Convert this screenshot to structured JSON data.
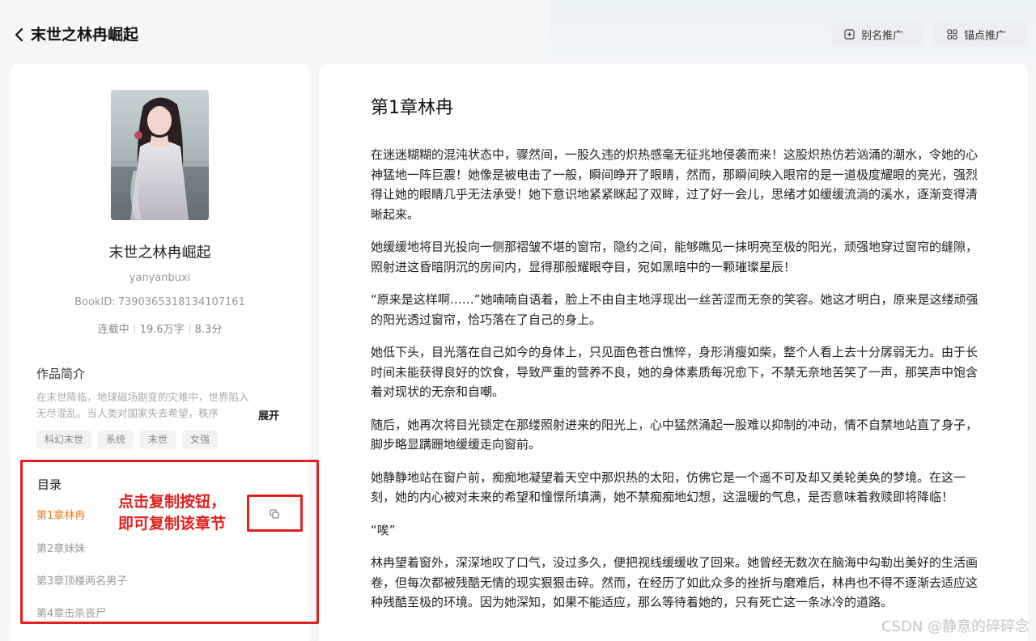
{
  "header": {
    "title": "末世之林冉崛起",
    "alias_button": "别名推广",
    "anchor_button": "锚点推广"
  },
  "book": {
    "title": "末世之林冉崛起",
    "author": "yanyanbuxi",
    "book_id_label": "BookID:",
    "book_id": "7390365318134107161",
    "status": "连载中",
    "word_count": "19.6万字",
    "rating": "8.3分"
  },
  "intro": {
    "heading": "作品简介",
    "text": "在末世降临，地球磁场剧变的灾难中，世界陷入无尽混乱。当人类对国家失去希望，秩序",
    "expand": "展开"
  },
  "tags": [
    "科幻末世",
    "系统",
    "末世",
    "女强"
  ],
  "toc": {
    "heading": "目录",
    "items": [
      "第1章林冉",
      "第2章妹妹",
      "第3章顶楼两名男子",
      "第4章击杀丧尸"
    ]
  },
  "annotation": {
    "line1": "点击复制按钮，",
    "line2": "即可复制该章节"
  },
  "chapter": {
    "title": "第1章林冉",
    "paragraphs": [
      "在迷迷糊糊的混沌状态中，骤然间，一股久违的炽热感毫无征兆地侵袭而来！这股炽热仿若汹涌的潮水，令她的心神猛地一阵巨震！她像是被电击了一般，瞬间睁开了眼睛，然而，那瞬间映入眼帘的是一道极度耀眼的亮光，强烈得让她的眼睛几乎无法承受！她下意识地紧紧眯起了双眸，过了好一会儿，思绪才如缓缓流淌的溪水，逐渐变得清晰起来。",
      "她缓缓地将目光投向一侧那褶皱不堪的窗帘，隐约之间，能够瞧见一抹明亮至极的阳光，顽强地穿过窗帘的缝隙，照射进这昏暗阴沉的房间内，显得那般耀眼夺目，宛如黑暗中的一颗璀璨星辰！",
      "“原来是这样啊……”她喃喃自语着，脸上不由自主地浮现出一丝苦涩而无奈的笑容。她这才明白，原来是这缕顽强的阳光透过窗帘，恰巧落在了自己的身上。",
      "她低下头，目光落在自己如今的身体上，只见面色苍白憔悴，身形消瘦如柴，整个人看上去十分孱弱无力。由于长时间未能获得良好的饮食，导致严重的营养不良，她的身体素质每况愈下，不禁无奈地苦笑了一声，那笑声中饱含着对现状的无奈和自嘲。",
      "随后，她再次将目光锁定在那缕照射进来的阳光上，心中猛然涌起一股难以抑制的冲动，情不自禁地站直了身子，脚步略显蹒跚地缓缓走向窗前。",
      "她静静地站在窗户前，痴痴地凝望着天空中那炽热的太阳，仿佛它是一个遥不可及却又美轮美奂的梦境。在这一刻，她的内心被对未来的希望和憧憬所填满，她不禁痴痴地幻想，这温暖的气息，是否意味着救赎即将降临！",
      "“唉”",
      "林冉望着窗外，深深地叹了口气，没过多久，便把视线缓缓收了回来。她曾经无数次在脑海中勾勒出美好的生活画卷，但每次都被残酷无情的现实狠狠击碎。然而，在经历了如此众多的挫折与磨难后，林冉也不得不逐渐去适应这种残酷至极的环境。因为她深知，如果不能适应，那么等待着她的，只有死亡这一条冰冷的道路。"
    ]
  },
  "watermark": "CSDN @静意的碎碎念"
}
